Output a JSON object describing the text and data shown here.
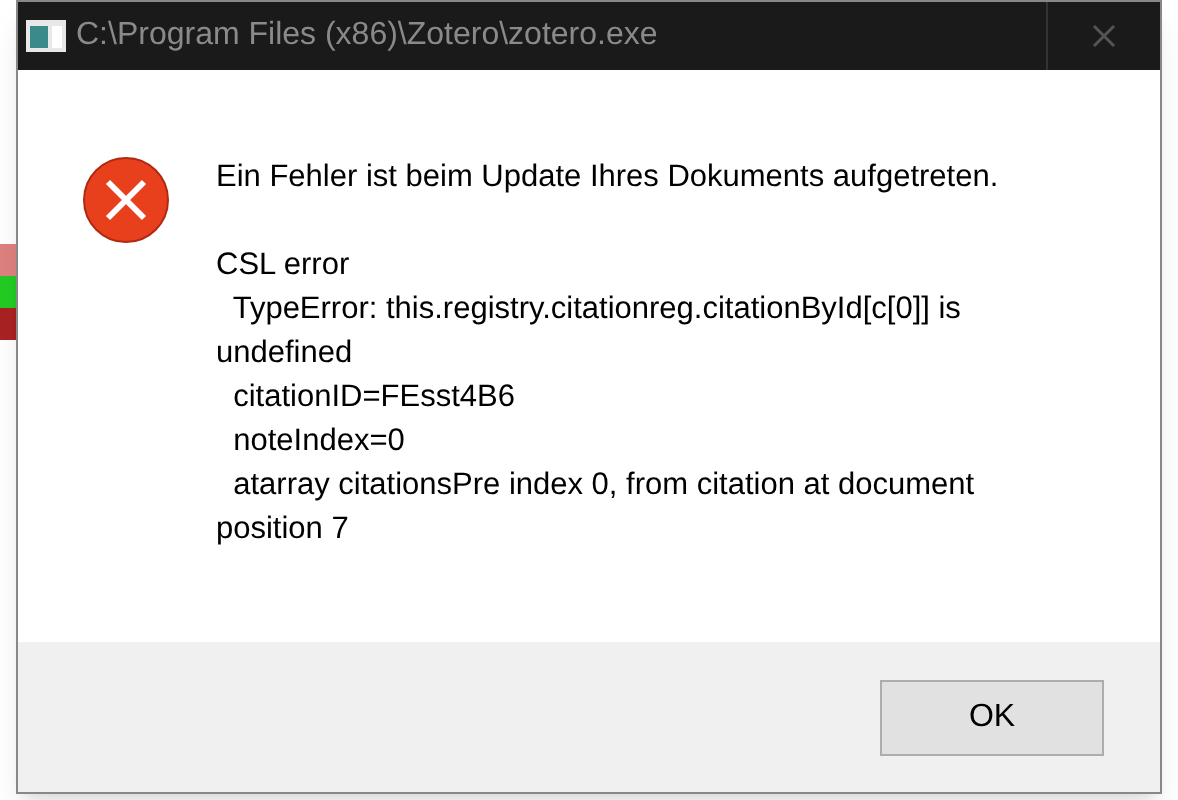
{
  "window": {
    "title": "C:\\Program Files (x86)\\Zotero\\zotero.exe"
  },
  "message": "Ein Fehler ist beim Update Ihres Dokuments aufgetreten.",
  "details": "CSL error\n  TypeError: this.registry.citationreg.citationById[c[0]] is\nundefined\n  citationID=FEsst4B6\n  noteIndex=0\n  atarray citationsPre index 0, from citation at document\nposition 7",
  "buttons": [
    {
      "label": "OK"
    }
  ]
}
